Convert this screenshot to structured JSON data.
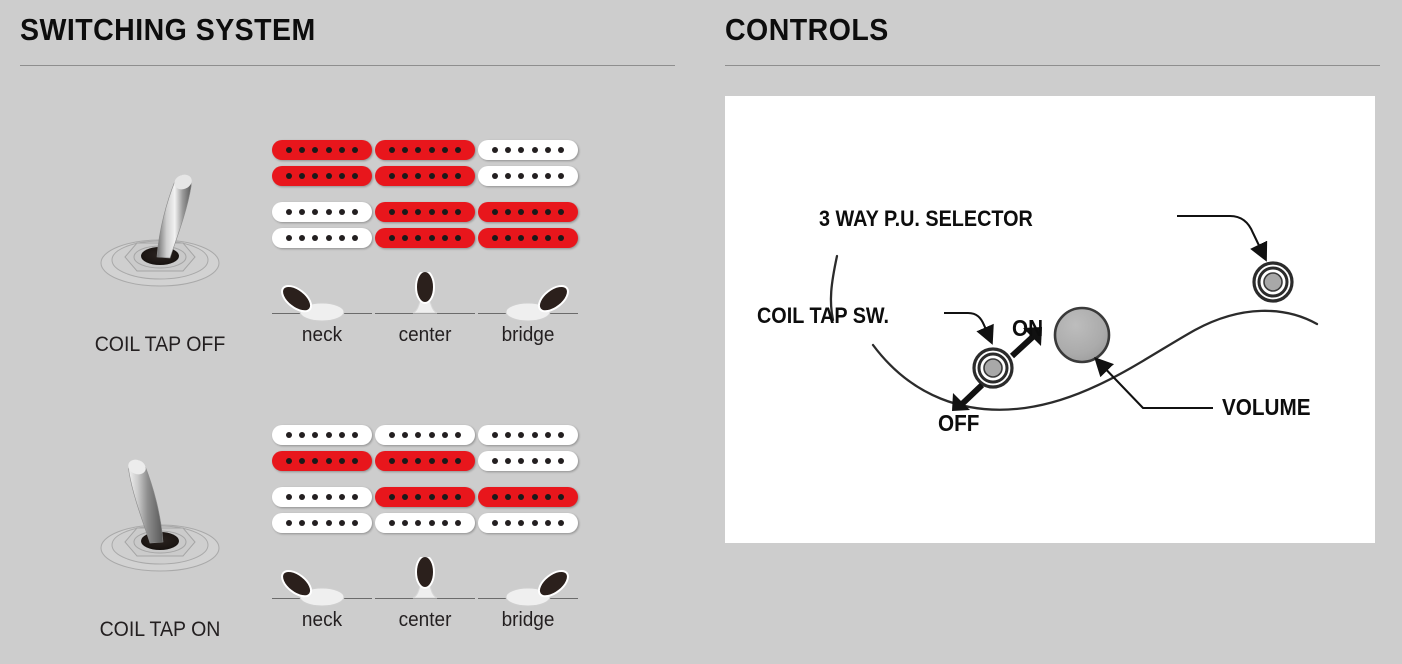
{
  "sections": {
    "switching": {
      "title": "SWITCHING SYSTEM"
    },
    "controls": {
      "title": "CONTROLS"
    }
  },
  "colors": {
    "background": "#cdcdcd",
    "panel": "#ffffff",
    "active_coil": "#e8161c",
    "inactive_coil": "#ffffff",
    "pole": "#231f20",
    "text": "#231f20",
    "rule": "#8e8e8e",
    "knob": "#a8a8a8"
  },
  "switching_system": {
    "blocks": [
      {
        "id": "coil-tap-off",
        "toggle_label": "COIL TAP OFF",
        "toggle_state": "off",
        "toggle_lean": "right",
        "positions": [
          {
            "label": "neck",
            "blade": "neck",
            "neck_pickup": {
              "top": "red",
              "bottom": "red"
            },
            "bridge_pickup": {
              "top": "white",
              "bottom": "white"
            }
          },
          {
            "label": "center",
            "blade": "center",
            "neck_pickup": {
              "top": "red",
              "bottom": "red"
            },
            "bridge_pickup": {
              "top": "red",
              "bottom": "red"
            }
          },
          {
            "label": "bridge",
            "blade": "bridge",
            "neck_pickup": {
              "top": "white",
              "bottom": "white"
            },
            "bridge_pickup": {
              "top": "red",
              "bottom": "red"
            }
          }
        ]
      },
      {
        "id": "coil-tap-on",
        "toggle_label": "COIL TAP ON",
        "toggle_state": "on",
        "toggle_lean": "left",
        "positions": [
          {
            "label": "neck",
            "blade": "neck",
            "neck_pickup": {
              "top": "white",
              "bottom": "red"
            },
            "bridge_pickup": {
              "top": "white",
              "bottom": "white"
            }
          },
          {
            "label": "center",
            "blade": "center",
            "neck_pickup": {
              "top": "white",
              "bottom": "red"
            },
            "bridge_pickup": {
              "top": "red",
              "bottom": "white"
            }
          },
          {
            "label": "bridge",
            "blade": "bridge",
            "neck_pickup": {
              "top": "white",
              "bottom": "white"
            },
            "bridge_pickup": {
              "top": "red",
              "bottom": "white"
            }
          }
        ]
      }
    ],
    "poles_per_coil": 6
  },
  "controls": {
    "labels": {
      "pu_selector": "3 WAY P.U. SELECTOR",
      "coil_tap_sw": "COIL TAP SW.",
      "on": "ON",
      "off": "OFF",
      "volume": "VOLUME"
    },
    "parts": [
      {
        "name": "3-way-pu-selector",
        "type": "rotary-switch"
      },
      {
        "name": "coil-tap-switch",
        "type": "rotary-switch"
      },
      {
        "name": "volume-knob",
        "type": "knob"
      }
    ]
  }
}
